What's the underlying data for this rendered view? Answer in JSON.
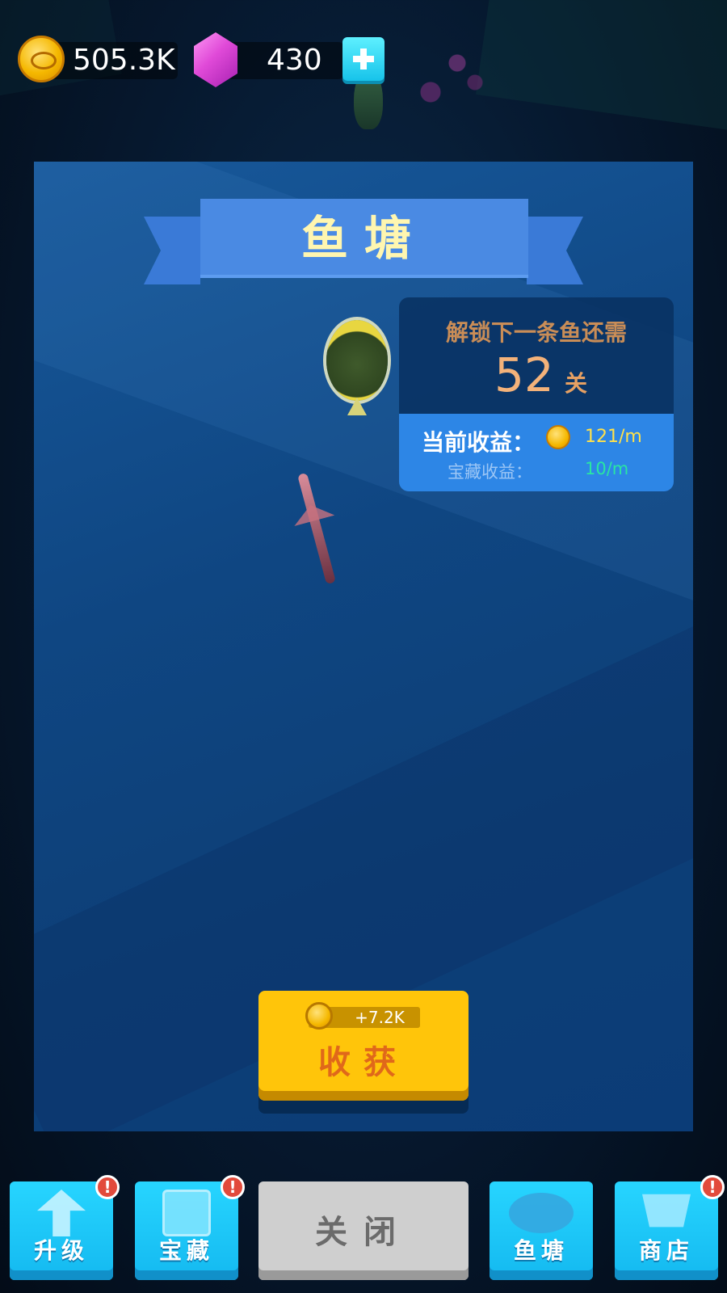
{
  "hud": {
    "coins": "505.3K",
    "gems": "430"
  },
  "panel": {
    "title": "鱼塘",
    "unlock_label": "解锁下一条鱼还需",
    "unlock_number": "52",
    "unlock_unit": "关",
    "income_label": "当前收益：",
    "income_value": "121/m",
    "treasure_label": "宝藏收益：",
    "treasure_value": "10/m"
  },
  "harvest": {
    "reward": "+7.2K",
    "label": "收获"
  },
  "bottom_bar": {
    "upgrade": "升级",
    "treasure": "宝藏",
    "close": "关闭",
    "pond": "鱼塘",
    "shop": "商店",
    "alert": "!"
  },
  "colors": {
    "coin": "#f5b800",
    "gem": "#e04ad8",
    "tab": "#14b9f0",
    "harvest": "#ffc50a",
    "alert": "#e24a3b"
  }
}
